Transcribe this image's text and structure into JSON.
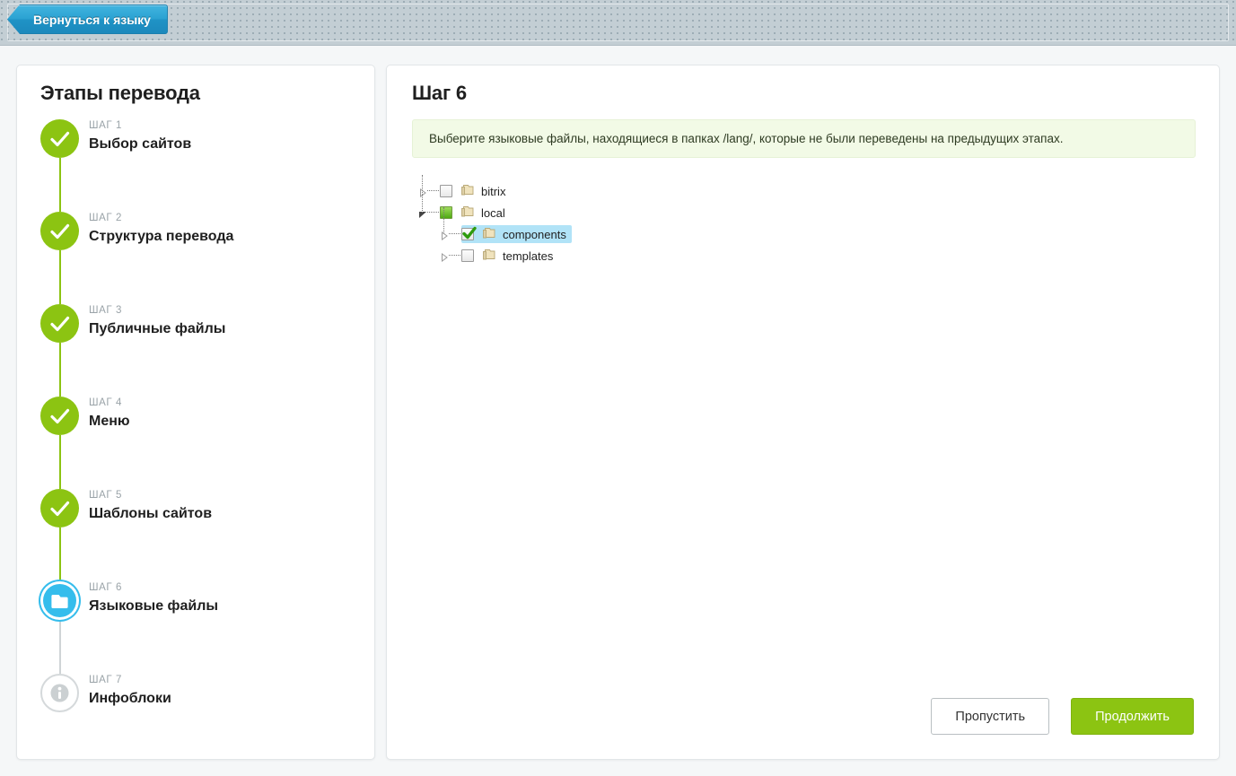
{
  "topbar": {
    "back_button_label": "Вернуться к языку",
    "back_button_color": "#2ba2d2"
  },
  "sidebar": {
    "title": "Этапы перевода",
    "accent_done_color": "#8cc412",
    "accent_current_color": "#35bdec",
    "pending_color": "#d5d9db",
    "steps": [
      {
        "label": "ШАГ 1",
        "name": "Выбор сайтов",
        "state": "done"
      },
      {
        "label": "ШАГ 2",
        "name": "Структура перевода",
        "state": "done"
      },
      {
        "label": "ШАГ 3",
        "name": "Публичные файлы",
        "state": "done"
      },
      {
        "label": "ШАГ 4",
        "name": "Меню",
        "state": "done"
      },
      {
        "label": "ШАГ 5",
        "name": "Шаблоны сайтов",
        "state": "done"
      },
      {
        "label": "ШАГ 6",
        "name": "Языковые файлы",
        "state": "current"
      },
      {
        "label": "ШАГ 7",
        "name": "Инфоблоки",
        "state": "pending"
      }
    ]
  },
  "main": {
    "title": "Шаг 6",
    "notice": "Выберите языковые файлы, находящиеся в папках /lang/, которые не были переведены на предыдущих этапах.",
    "notice_bg_color": "#f2fae6",
    "tree": [
      {
        "label": "bitrix",
        "depth": 0,
        "checkbox": "unchecked",
        "expanded": false,
        "selected": false
      },
      {
        "label": "local",
        "depth": 0,
        "checkbox": "partial",
        "expanded": true,
        "selected": false
      },
      {
        "label": "components",
        "depth": 1,
        "checkbox": "checked",
        "expanded": false,
        "selected": true
      },
      {
        "label": "templates",
        "depth": 1,
        "checkbox": "unchecked",
        "expanded": false,
        "selected": false
      }
    ],
    "buttons": {
      "skip": "Пропустить",
      "continue": "Продолжить",
      "continue_color": "#8cc412"
    }
  }
}
